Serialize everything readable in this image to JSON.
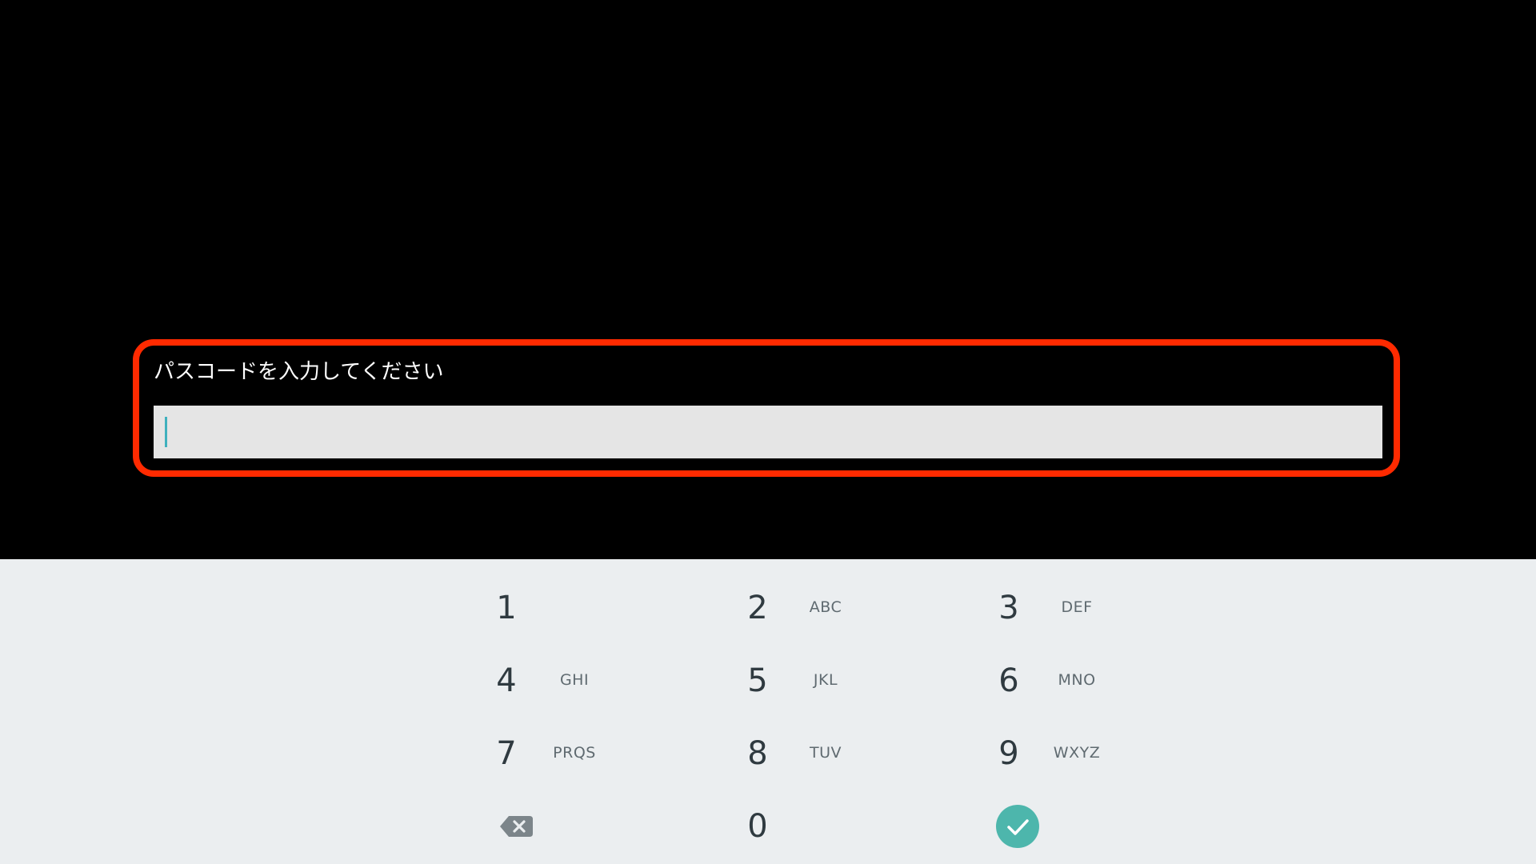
{
  "prompt": {
    "label": "パスコードを入力してください"
  },
  "passcode_input": {
    "value": ""
  },
  "keypad": {
    "keys": [
      {
        "digit": "1",
        "letters": ""
      },
      {
        "digit": "2",
        "letters": "ABC"
      },
      {
        "digit": "3",
        "letters": "DEF"
      },
      {
        "digit": "4",
        "letters": "GHI"
      },
      {
        "digit": "5",
        "letters": "JKL"
      },
      {
        "digit": "6",
        "letters": "MNO"
      },
      {
        "digit": "7",
        "letters": "PRQS"
      },
      {
        "digit": "8",
        "letters": "TUV"
      },
      {
        "digit": "9",
        "letters": "WXYZ"
      },
      {
        "digit": "0",
        "letters": ""
      }
    ],
    "backspace_icon": "backspace-icon",
    "confirm_icon": "checkmark-icon"
  },
  "colors": {
    "background": "#000000",
    "highlight_frame": "#ff2a00",
    "input_background": "#e5e5e5",
    "cursor": "#3fb1bd",
    "keypad_background": "#ebeef0",
    "confirm_button": "#4db6ac",
    "digit_text": "#2f3a40",
    "letters_text": "#5f6a70"
  }
}
